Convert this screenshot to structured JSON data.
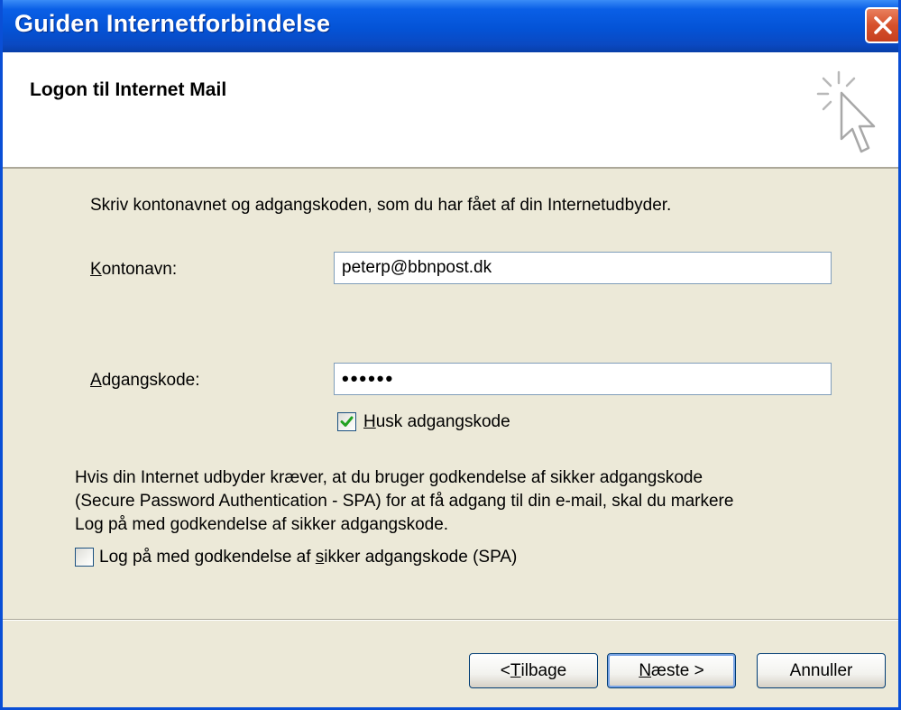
{
  "window": {
    "title": "Guiden Internetforbindelse"
  },
  "header": {
    "title": "Logon til Internet Mail"
  },
  "instructions": "Skriv kontonavnet og adgangskoden, som du har fået af din Internetudbyder.",
  "account": {
    "label_key": "K",
    "label_rest": "ontonavn:",
    "value": "peterp@bbnpost.dk"
  },
  "password": {
    "label_key": "A",
    "label_rest": "dgangskode:",
    "value": "••••••"
  },
  "remember": {
    "key": "H",
    "rest": "usk adgangskode",
    "checked": true
  },
  "spa": {
    "info_lines": [
      "Hvis din Internet udbyder kræver, at du bruger godkendelse af sikker adgangskode",
      "(Secure Password Authentication - SPA) for at få adgang til din e-mail, skal du markere",
      "Log på med godkendelse af sikker adgangskode."
    ],
    "label_pre": "Log på med godkendelse af ",
    "label_key": "s",
    "label_post": "ikker adgangskode (SPA)",
    "checked": false
  },
  "buttons": {
    "back": {
      "pre": "< ",
      "key": "T",
      "rest": "ilbage"
    },
    "next": {
      "key": "N",
      "rest": "æste >"
    },
    "cancel": {
      "label": "Annuller"
    }
  },
  "colors": {
    "titlebar": "#0453D6",
    "frame": "#ECE9D8",
    "close": "#D6512B",
    "check": "#21A121"
  },
  "icons": {
    "wizard": "cursor-sparkle-icon",
    "close": "close-icon",
    "check": "checkmark-icon"
  }
}
